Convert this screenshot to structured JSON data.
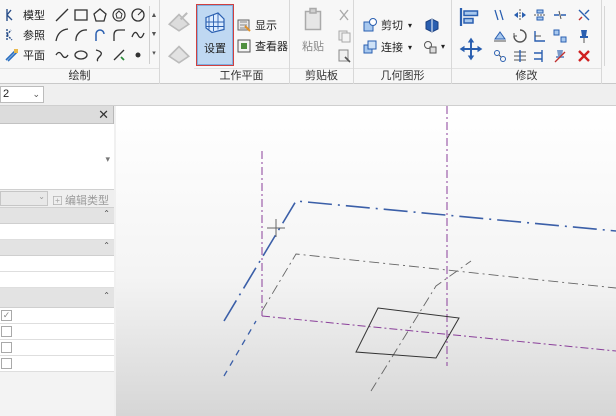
{
  "ribbon": {
    "draw": {
      "label": "绘制",
      "model_label": "模型",
      "ref_label": "参照",
      "plane_label": "平面"
    },
    "workplane": {
      "label": "工作平面",
      "set_label": "设置",
      "show_label": "显示",
      "viewer_label": "查看器"
    },
    "clipboard": {
      "label": "剪贴板",
      "paste_label": "粘贴"
    },
    "geometry": {
      "label": "几何图形",
      "cut_label": "剪切",
      "join_label": "连接"
    },
    "modify": {
      "label": "修改"
    }
  },
  "view_combo": {
    "value": "2"
  },
  "properties": {
    "edit_type_label": "编辑类型",
    "checked_mark": "✓"
  },
  "colors": {
    "accent": "#3f7fd0",
    "set_button_bg": "#bfd8f2",
    "reference_plane": "#8a3f9a",
    "level_line": "#3b5fa8"
  }
}
